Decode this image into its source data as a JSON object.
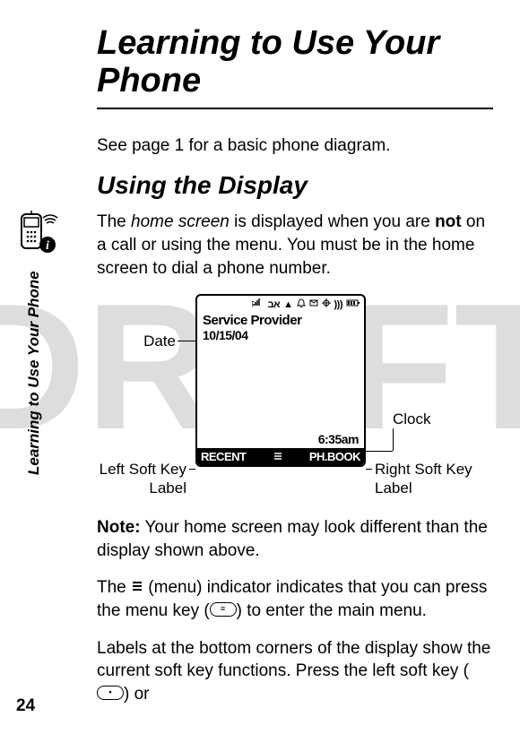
{
  "watermark": "DRAFT",
  "title": "Learning to Use Your Phone",
  "side_label": "Learning to Use Your Phone",
  "page_number": "24",
  "intro": "See page 1 for a basic phone diagram.",
  "subhead": "Using the Display",
  "home_screen_para": {
    "p1a": "The ",
    "p1_italic": "home screen",
    "p1b": " is displayed when you are ",
    "p1_bold": "not",
    "p1c": " on a call or using the menu. You must be in the home screen to dial a phone number."
  },
  "diagram_callouts": {
    "date": "Date",
    "clock": "Clock",
    "left_soft": "Left Soft Key Label",
    "right_soft": "Right Soft Key Label"
  },
  "screen": {
    "service_provider": "Service Provider",
    "date": "10/15/04",
    "clock": "6:35am",
    "left_soft": "RECENT",
    "right_soft": "PH.BOOK",
    "status_icons": "אב"
  },
  "note": {
    "bold": "Note:",
    "text": " Your home screen may look different than the display shown above."
  },
  "para3a": "The ",
  "para3b": " (menu) indicator indicates that you can press the menu key (",
  "para3c": ") to enter the main menu.",
  "para4a": "Labels at the bottom corners of the display show the current soft key functions. Press the left soft key (",
  "para4b": ") or",
  "key_menu_inner": "≡",
  "key_left_inner": "•"
}
